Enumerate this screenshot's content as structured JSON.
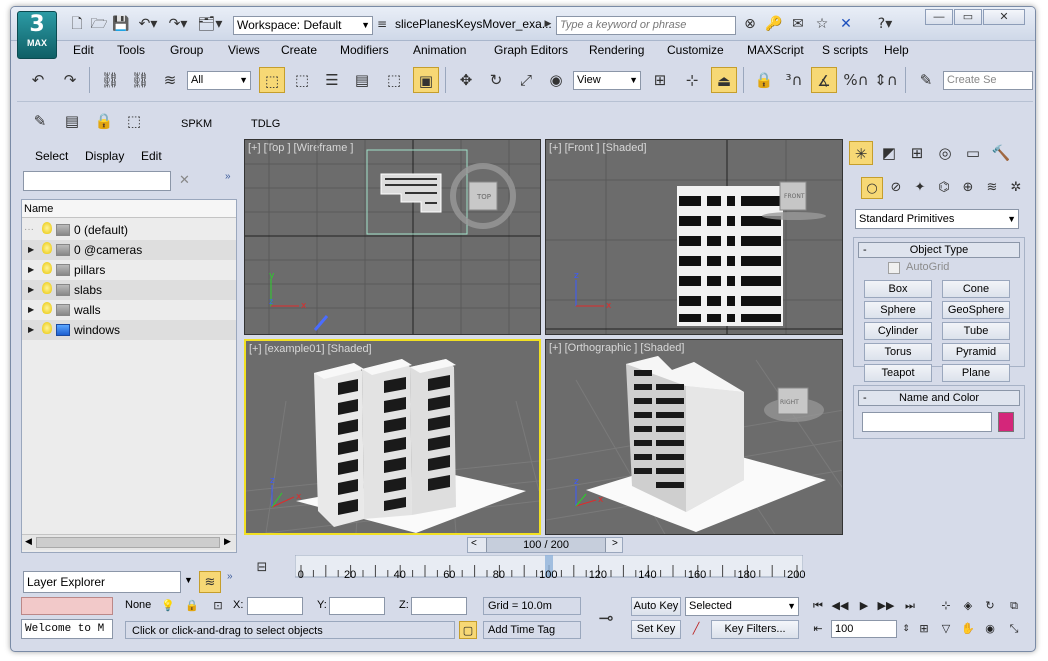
{
  "titlebar": {
    "workspace": "Workspace: Default",
    "document_title": "slicePlanesKeysMover_exa...",
    "search_placeholder": "Type a keyword or phrase",
    "logo_label": "MAX",
    "help_label": "?"
  },
  "menu": [
    "Edit",
    "Tools",
    "Group",
    "Views",
    "Create",
    "Modifiers",
    "Animation",
    "Graph Editors",
    "Rendering",
    "Customize",
    "MAXScript",
    "S scripts",
    "Help"
  ],
  "main_toolbar": {
    "selection_filter": "All",
    "reference_coord": "View",
    "create_selection_set": "Create Se"
  },
  "custom_toolbar": {
    "spkm_label": "SPKM",
    "tdlg_label": "TDLG"
  },
  "scene_explorer": {
    "tabs": [
      "Select",
      "Display",
      "Edit"
    ],
    "column_header": "Name",
    "layers": [
      {
        "name": "0 (default)",
        "expandable": false,
        "highlight": false
      },
      {
        "name": "0 @cameras",
        "expandable": true,
        "highlight": false
      },
      {
        "name": "pillars",
        "expandable": true,
        "highlight": false
      },
      {
        "name": "slabs",
        "expandable": true,
        "highlight": false
      },
      {
        "name": "walls",
        "expandable": true,
        "highlight": false
      },
      {
        "name": "windows",
        "expandable": true,
        "highlight": true
      }
    ],
    "footer_combo": "Layer Explorer"
  },
  "viewports": [
    {
      "label": "[+] [Top ] [Wireframe ]"
    },
    {
      "label": "[+] [Front ] [Shaded]"
    },
    {
      "label": "[+] [example01] [Shaded]"
    },
    {
      "label": "[+] [Orthographic ] [Shaded]"
    }
  ],
  "command_panel": {
    "category_combo": "Standard Primitives",
    "object_type_header": "Object Type",
    "autogrid_label": "AutoGrid",
    "buttons": [
      "Box",
      "Cone",
      "Sphere",
      "GeoSphere",
      "Cylinder",
      "Tube",
      "Torus",
      "Pyramid",
      "Teapot",
      "Plane"
    ],
    "name_color_header": "Name and Color",
    "object_color": "#d4267a"
  },
  "time_slider": {
    "frame_display": "100 / 200",
    "ticks": [
      "0",
      "20",
      "40",
      "60",
      "80",
      "100",
      "120",
      "140",
      "160",
      "180",
      "200"
    ],
    "current_frame": 100,
    "max_frame": 200
  },
  "status": {
    "selection_state": "None",
    "x_label": "X:",
    "y_label": "Y:",
    "z_label": "Z:",
    "grid": "Grid = 10.0m",
    "listener": "Welcome to M",
    "prompt": "Click or click-and-drag to select objects",
    "add_time_tag": "Add Time Tag",
    "auto_key": "Auto Key",
    "set_key": "Set Key",
    "key_filter_combo": "Selected",
    "key_filters": "Key Filters...",
    "frame_field": "100"
  }
}
